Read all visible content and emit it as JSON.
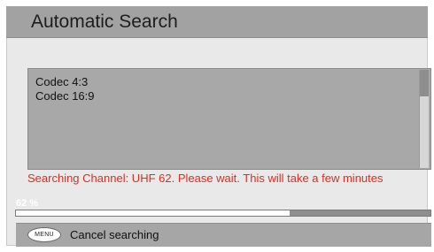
{
  "window": {
    "title": "Automatic Search"
  },
  "channel_list": {
    "items": [
      {
        "label": "Codec 4:3"
      },
      {
        "label": "Codec 16:9"
      }
    ]
  },
  "status": {
    "text": "Searching Channel: UHF 62.  Please wait. This will take a few minutes"
  },
  "progress": {
    "label": "62 %",
    "fraction": 0.66
  },
  "footer": {
    "menu_key": "MENU",
    "cancel_label": "Cancel searching"
  },
  "colors": {
    "status_text": "#e32b1c",
    "titlebar": "#a2a2a2",
    "panel": "#e9e9e9"
  }
}
